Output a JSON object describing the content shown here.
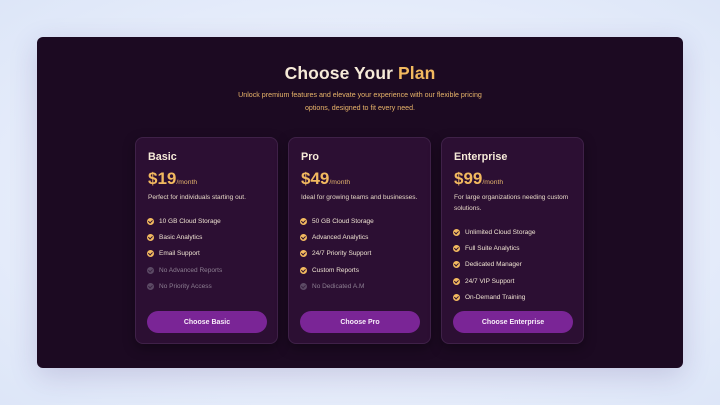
{
  "header": {
    "title_part1": "Choose Your",
    "title_part2": "Plan",
    "subtitle": "Unlock premium features and elevate your experience with our flexible pricing options, designed to fit every need."
  },
  "colors": {
    "panel_background": "#1c0a22",
    "card_background": "#2c0f33",
    "accent_gold": "#f2b95f",
    "button_purple": "#7a2596"
  },
  "plans": [
    {
      "name": "Basic",
      "price": "$19",
      "period": "/month",
      "description": "Perfect for individuals starting out.",
      "features": [
        {
          "label": "10 GB Cloud Storage",
          "included": true,
          "icon": "check-circle-icon"
        },
        {
          "label": "Basic Analytics",
          "included": true,
          "icon": "check-circle-icon"
        },
        {
          "label": "Email Support",
          "included": true,
          "icon": "check-circle-icon"
        },
        {
          "label": "No Advanced Reports",
          "included": false,
          "icon": "disabled-circle-icon"
        },
        {
          "label": "No Priority Access",
          "included": false,
          "icon": "disabled-circle-icon"
        }
      ],
      "button_label": "Choose Basic"
    },
    {
      "name": "Pro",
      "price": "$49",
      "period": "/month",
      "description": "Ideal for growing teams and businesses.",
      "features": [
        {
          "label": "50 GB Cloud Storage",
          "included": true,
          "icon": "check-circle-icon"
        },
        {
          "label": "Advanced Analytics",
          "included": true,
          "icon": "check-circle-icon"
        },
        {
          "label": "24/7 Priority Support",
          "included": true,
          "icon": "check-circle-icon"
        },
        {
          "label": "Custom Reports",
          "included": true,
          "icon": "check-circle-icon"
        },
        {
          "label": "No Dedicated A.M",
          "included": false,
          "icon": "disabled-circle-icon"
        }
      ],
      "button_label": "Choose Pro"
    },
    {
      "name": "Enterprise",
      "price": "$99",
      "period": "/month",
      "description": "For large organizations needing custom solutions.",
      "features": [
        {
          "label": "Unlimited Cloud Storage",
          "included": true,
          "icon": "check-circle-icon"
        },
        {
          "label": "Full Suite Analytics",
          "included": true,
          "icon": "check-circle-icon"
        },
        {
          "label": "Dedicated Manager",
          "included": true,
          "icon": "check-circle-icon"
        },
        {
          "label": "24/7 VIP Support",
          "included": true,
          "icon": "check-circle-icon"
        },
        {
          "label": "On-Demand Training",
          "included": true,
          "icon": "check-circle-icon"
        }
      ],
      "button_label": "Choose Enterprise"
    }
  ]
}
